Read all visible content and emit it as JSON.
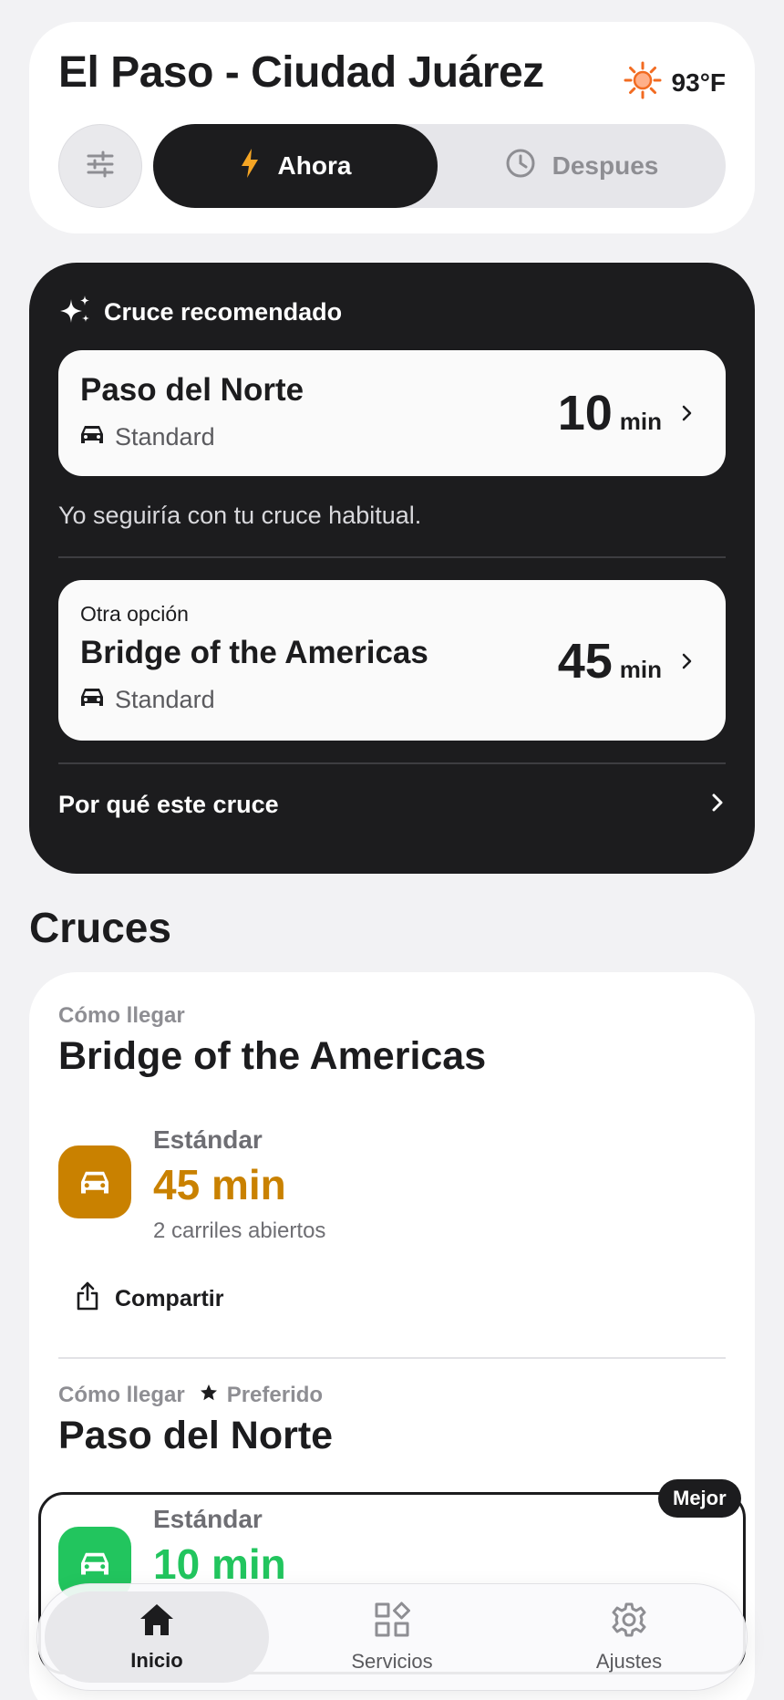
{
  "header": {
    "city": "El Paso - Ciudad Juárez",
    "temperature": "93°F",
    "weather_icon": "sun-icon",
    "segment": {
      "now_label": "Ahora",
      "later_label": "Despues",
      "selected": "now"
    }
  },
  "recommendation": {
    "heading": "Cruce recomendado",
    "primary": {
      "name": "Paso del Norte",
      "lane": "Standard",
      "time": "10",
      "unit": "min"
    },
    "note": "Yo seguiría con tu cruce habitual.",
    "alternative": {
      "kicker": "Otra opción",
      "name": "Bridge of the Americas",
      "lane": "Standard",
      "time": "45",
      "unit": "min"
    },
    "why_label": "Por qué este cruce"
  },
  "crossings": {
    "title": "Cruces",
    "items": [
      {
        "how_label": "Cómo llegar",
        "name": "Bridge of the Americas",
        "lane_type": "Estándar",
        "wait": "45 min",
        "lanes_open": "2 carriles abiertos",
        "share_label": "Compartir",
        "color": "#c98100"
      },
      {
        "how_label": "Cómo llegar",
        "preferred_label": "Preferido",
        "name": "Paso del Norte",
        "lane_type": "Estándar",
        "wait": "10 min",
        "best_badge": "Mejor",
        "color": "#22c55e"
      }
    ]
  },
  "tabbar": {
    "items": [
      {
        "label": "Inicio",
        "icon": "home-icon",
        "active": true
      },
      {
        "label": "Servicios",
        "icon": "grid-icon",
        "active": false
      },
      {
        "label": "Ajustes",
        "icon": "gear-icon",
        "active": false
      }
    ]
  },
  "colors": {
    "dark": "#1c1c1e",
    "amber": "#c98100",
    "green": "#22c55e",
    "sun": "#f26b21"
  }
}
